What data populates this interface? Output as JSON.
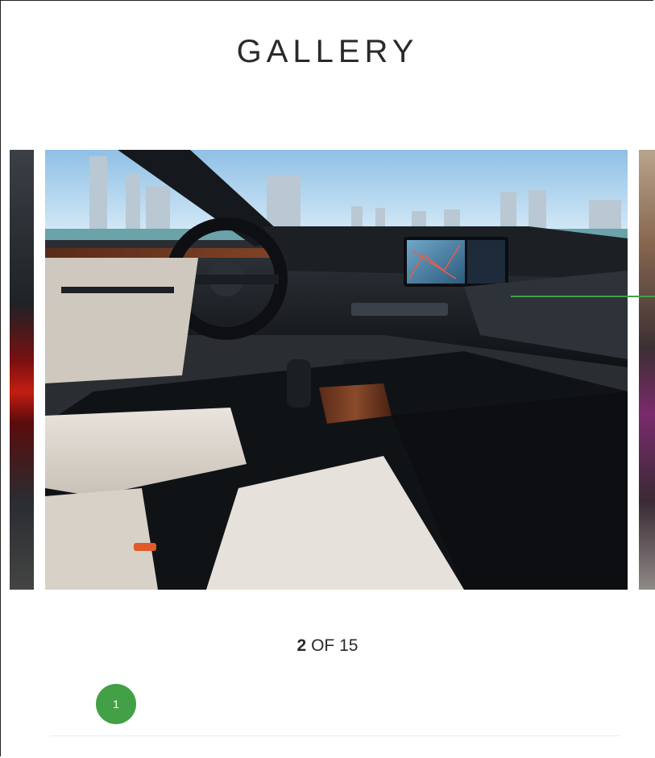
{
  "gallery": {
    "title": "GALLERY",
    "counter": {
      "current": "2",
      "separator": " OF ",
      "total": "15"
    },
    "slides": [
      {
        "name": "previous-slide",
        "description_icon": "car-taillight-image"
      },
      {
        "name": "current-slide",
        "description_icon": "car-interior-image"
      },
      {
        "name": "next-slide",
        "description_icon": "person-image"
      }
    ]
  },
  "annotation": {
    "badge_label": "1",
    "color": "#43a047"
  }
}
